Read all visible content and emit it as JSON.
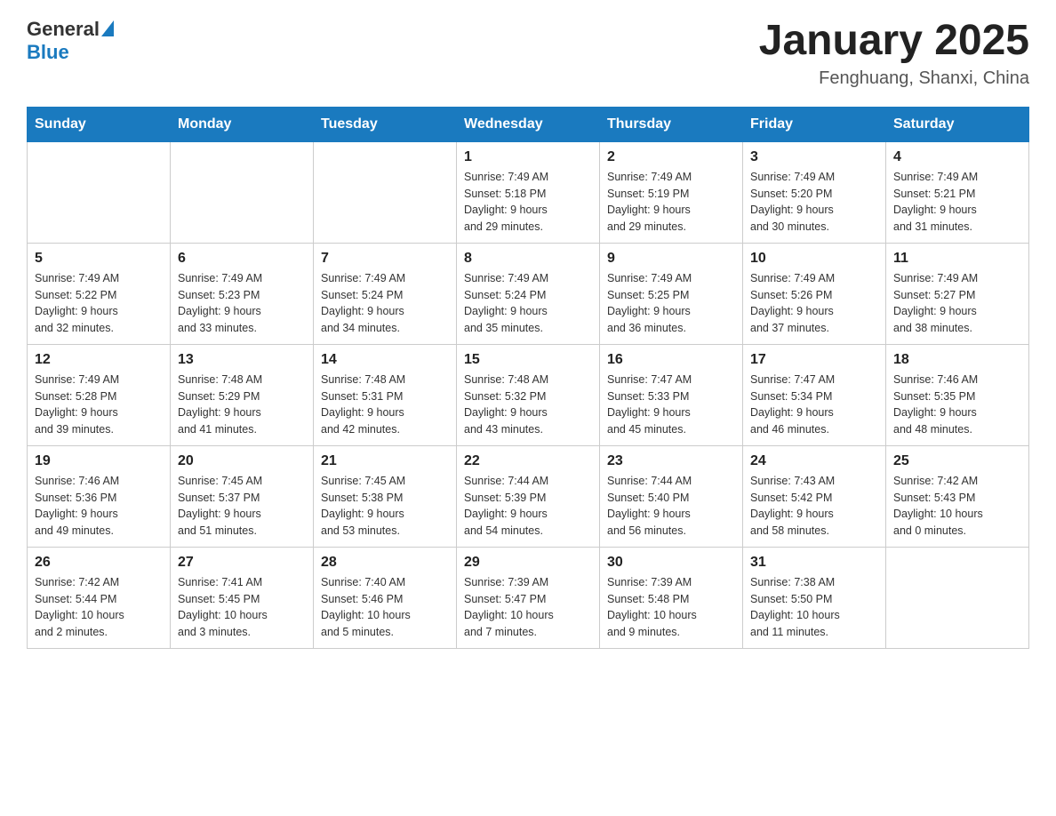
{
  "header": {
    "logo": {
      "general": "General",
      "blue": "Blue"
    },
    "title": "January 2025",
    "location": "Fenghuang, Shanxi, China"
  },
  "calendar": {
    "days_of_week": [
      "Sunday",
      "Monday",
      "Tuesday",
      "Wednesday",
      "Thursday",
      "Friday",
      "Saturday"
    ],
    "weeks": [
      [
        {
          "day": "",
          "info": ""
        },
        {
          "day": "",
          "info": ""
        },
        {
          "day": "",
          "info": ""
        },
        {
          "day": "1",
          "info": "Sunrise: 7:49 AM\nSunset: 5:18 PM\nDaylight: 9 hours\nand 29 minutes."
        },
        {
          "day": "2",
          "info": "Sunrise: 7:49 AM\nSunset: 5:19 PM\nDaylight: 9 hours\nand 29 minutes."
        },
        {
          "day": "3",
          "info": "Sunrise: 7:49 AM\nSunset: 5:20 PM\nDaylight: 9 hours\nand 30 minutes."
        },
        {
          "day": "4",
          "info": "Sunrise: 7:49 AM\nSunset: 5:21 PM\nDaylight: 9 hours\nand 31 minutes."
        }
      ],
      [
        {
          "day": "5",
          "info": "Sunrise: 7:49 AM\nSunset: 5:22 PM\nDaylight: 9 hours\nand 32 minutes."
        },
        {
          "day": "6",
          "info": "Sunrise: 7:49 AM\nSunset: 5:23 PM\nDaylight: 9 hours\nand 33 minutes."
        },
        {
          "day": "7",
          "info": "Sunrise: 7:49 AM\nSunset: 5:24 PM\nDaylight: 9 hours\nand 34 minutes."
        },
        {
          "day": "8",
          "info": "Sunrise: 7:49 AM\nSunset: 5:24 PM\nDaylight: 9 hours\nand 35 minutes."
        },
        {
          "day": "9",
          "info": "Sunrise: 7:49 AM\nSunset: 5:25 PM\nDaylight: 9 hours\nand 36 minutes."
        },
        {
          "day": "10",
          "info": "Sunrise: 7:49 AM\nSunset: 5:26 PM\nDaylight: 9 hours\nand 37 minutes."
        },
        {
          "day": "11",
          "info": "Sunrise: 7:49 AM\nSunset: 5:27 PM\nDaylight: 9 hours\nand 38 minutes."
        }
      ],
      [
        {
          "day": "12",
          "info": "Sunrise: 7:49 AM\nSunset: 5:28 PM\nDaylight: 9 hours\nand 39 minutes."
        },
        {
          "day": "13",
          "info": "Sunrise: 7:48 AM\nSunset: 5:29 PM\nDaylight: 9 hours\nand 41 minutes."
        },
        {
          "day": "14",
          "info": "Sunrise: 7:48 AM\nSunset: 5:31 PM\nDaylight: 9 hours\nand 42 minutes."
        },
        {
          "day": "15",
          "info": "Sunrise: 7:48 AM\nSunset: 5:32 PM\nDaylight: 9 hours\nand 43 minutes."
        },
        {
          "day": "16",
          "info": "Sunrise: 7:47 AM\nSunset: 5:33 PM\nDaylight: 9 hours\nand 45 minutes."
        },
        {
          "day": "17",
          "info": "Sunrise: 7:47 AM\nSunset: 5:34 PM\nDaylight: 9 hours\nand 46 minutes."
        },
        {
          "day": "18",
          "info": "Sunrise: 7:46 AM\nSunset: 5:35 PM\nDaylight: 9 hours\nand 48 minutes."
        }
      ],
      [
        {
          "day": "19",
          "info": "Sunrise: 7:46 AM\nSunset: 5:36 PM\nDaylight: 9 hours\nand 49 minutes."
        },
        {
          "day": "20",
          "info": "Sunrise: 7:45 AM\nSunset: 5:37 PM\nDaylight: 9 hours\nand 51 minutes."
        },
        {
          "day": "21",
          "info": "Sunrise: 7:45 AM\nSunset: 5:38 PM\nDaylight: 9 hours\nand 53 minutes."
        },
        {
          "day": "22",
          "info": "Sunrise: 7:44 AM\nSunset: 5:39 PM\nDaylight: 9 hours\nand 54 minutes."
        },
        {
          "day": "23",
          "info": "Sunrise: 7:44 AM\nSunset: 5:40 PM\nDaylight: 9 hours\nand 56 minutes."
        },
        {
          "day": "24",
          "info": "Sunrise: 7:43 AM\nSunset: 5:42 PM\nDaylight: 9 hours\nand 58 minutes."
        },
        {
          "day": "25",
          "info": "Sunrise: 7:42 AM\nSunset: 5:43 PM\nDaylight: 10 hours\nand 0 minutes."
        }
      ],
      [
        {
          "day": "26",
          "info": "Sunrise: 7:42 AM\nSunset: 5:44 PM\nDaylight: 10 hours\nand 2 minutes."
        },
        {
          "day": "27",
          "info": "Sunrise: 7:41 AM\nSunset: 5:45 PM\nDaylight: 10 hours\nand 3 minutes."
        },
        {
          "day": "28",
          "info": "Sunrise: 7:40 AM\nSunset: 5:46 PM\nDaylight: 10 hours\nand 5 minutes."
        },
        {
          "day": "29",
          "info": "Sunrise: 7:39 AM\nSunset: 5:47 PM\nDaylight: 10 hours\nand 7 minutes."
        },
        {
          "day": "30",
          "info": "Sunrise: 7:39 AM\nSunset: 5:48 PM\nDaylight: 10 hours\nand 9 minutes."
        },
        {
          "day": "31",
          "info": "Sunrise: 7:38 AM\nSunset: 5:50 PM\nDaylight: 10 hours\nand 11 minutes."
        },
        {
          "day": "",
          "info": ""
        }
      ]
    ]
  }
}
